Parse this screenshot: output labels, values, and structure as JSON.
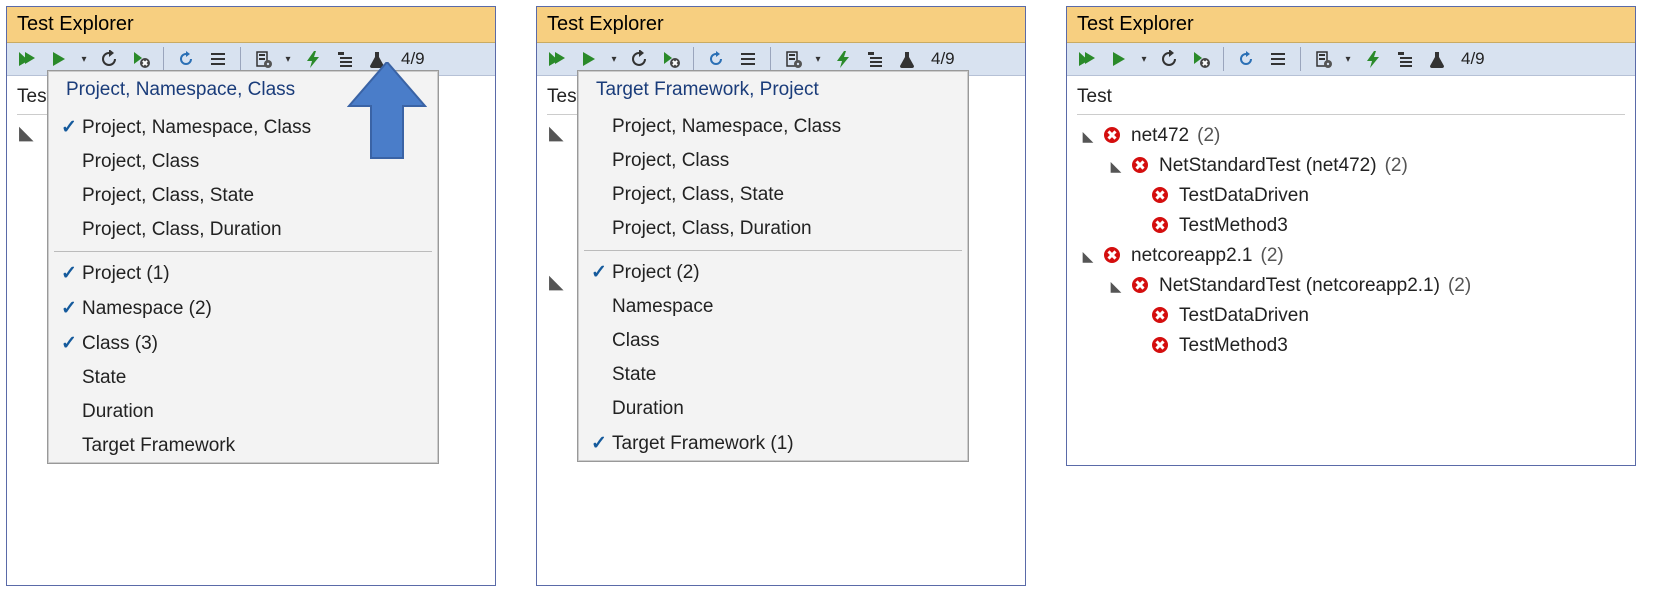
{
  "common": {
    "title": "Test Explorer",
    "summary": "4/9",
    "tab_label": "Test"
  },
  "panel1": {
    "menu_header": "Project, Namespace, Class",
    "presets": [
      {
        "label": "Project, Namespace, Class",
        "checked": true
      },
      {
        "label": "Project, Class",
        "checked": false
      },
      {
        "label": "Project, Class, State",
        "checked": false
      },
      {
        "label": "Project, Class, Duration",
        "checked": false
      }
    ],
    "groups": [
      {
        "label": "Project (1)",
        "checked": true
      },
      {
        "label": "Namespace (2)",
        "checked": true
      },
      {
        "label": "Class (3)",
        "checked": true
      },
      {
        "label": "State",
        "checked": false
      },
      {
        "label": "Duration",
        "checked": false
      },
      {
        "label": "Target Framework",
        "checked": false
      }
    ]
  },
  "panel2": {
    "menu_header": "Target Framework, Project",
    "presets": [
      {
        "label": "Project, Namespace, Class",
        "checked": false
      },
      {
        "label": "Project, Class",
        "checked": false
      },
      {
        "label": "Project, Class, State",
        "checked": false
      },
      {
        "label": "Project, Class, Duration",
        "checked": false
      }
    ],
    "groups": [
      {
        "label": "Project (2)",
        "checked": true
      },
      {
        "label": "Namespace",
        "checked": false
      },
      {
        "label": "Class",
        "checked": false
      },
      {
        "label": "State",
        "checked": false
      },
      {
        "label": "Duration",
        "checked": false
      },
      {
        "label": "Target Framework (1)",
        "checked": true
      }
    ]
  },
  "panel3": {
    "nodes": [
      {
        "level": 0,
        "exp": "▲",
        "label": "net472",
        "count": "(2)"
      },
      {
        "level": 1,
        "exp": "▲",
        "label": "NetStandardTest (net472)",
        "count": "(2)"
      },
      {
        "level": 2,
        "exp": "",
        "label": "TestDataDriven",
        "count": ""
      },
      {
        "level": 2,
        "exp": "",
        "label": "TestMethod3",
        "count": ""
      },
      {
        "level": 0,
        "exp": "▲",
        "label": "netcoreapp2.1",
        "count": "(2)"
      },
      {
        "level": 1,
        "exp": "▲",
        "label": "NetStandardTest (netcoreapp2.1)",
        "count": "(2)"
      },
      {
        "level": 2,
        "exp": "",
        "label": "TestDataDriven",
        "count": ""
      },
      {
        "level": 2,
        "exp": "",
        "label": "TestMethod3",
        "count": ""
      }
    ]
  }
}
